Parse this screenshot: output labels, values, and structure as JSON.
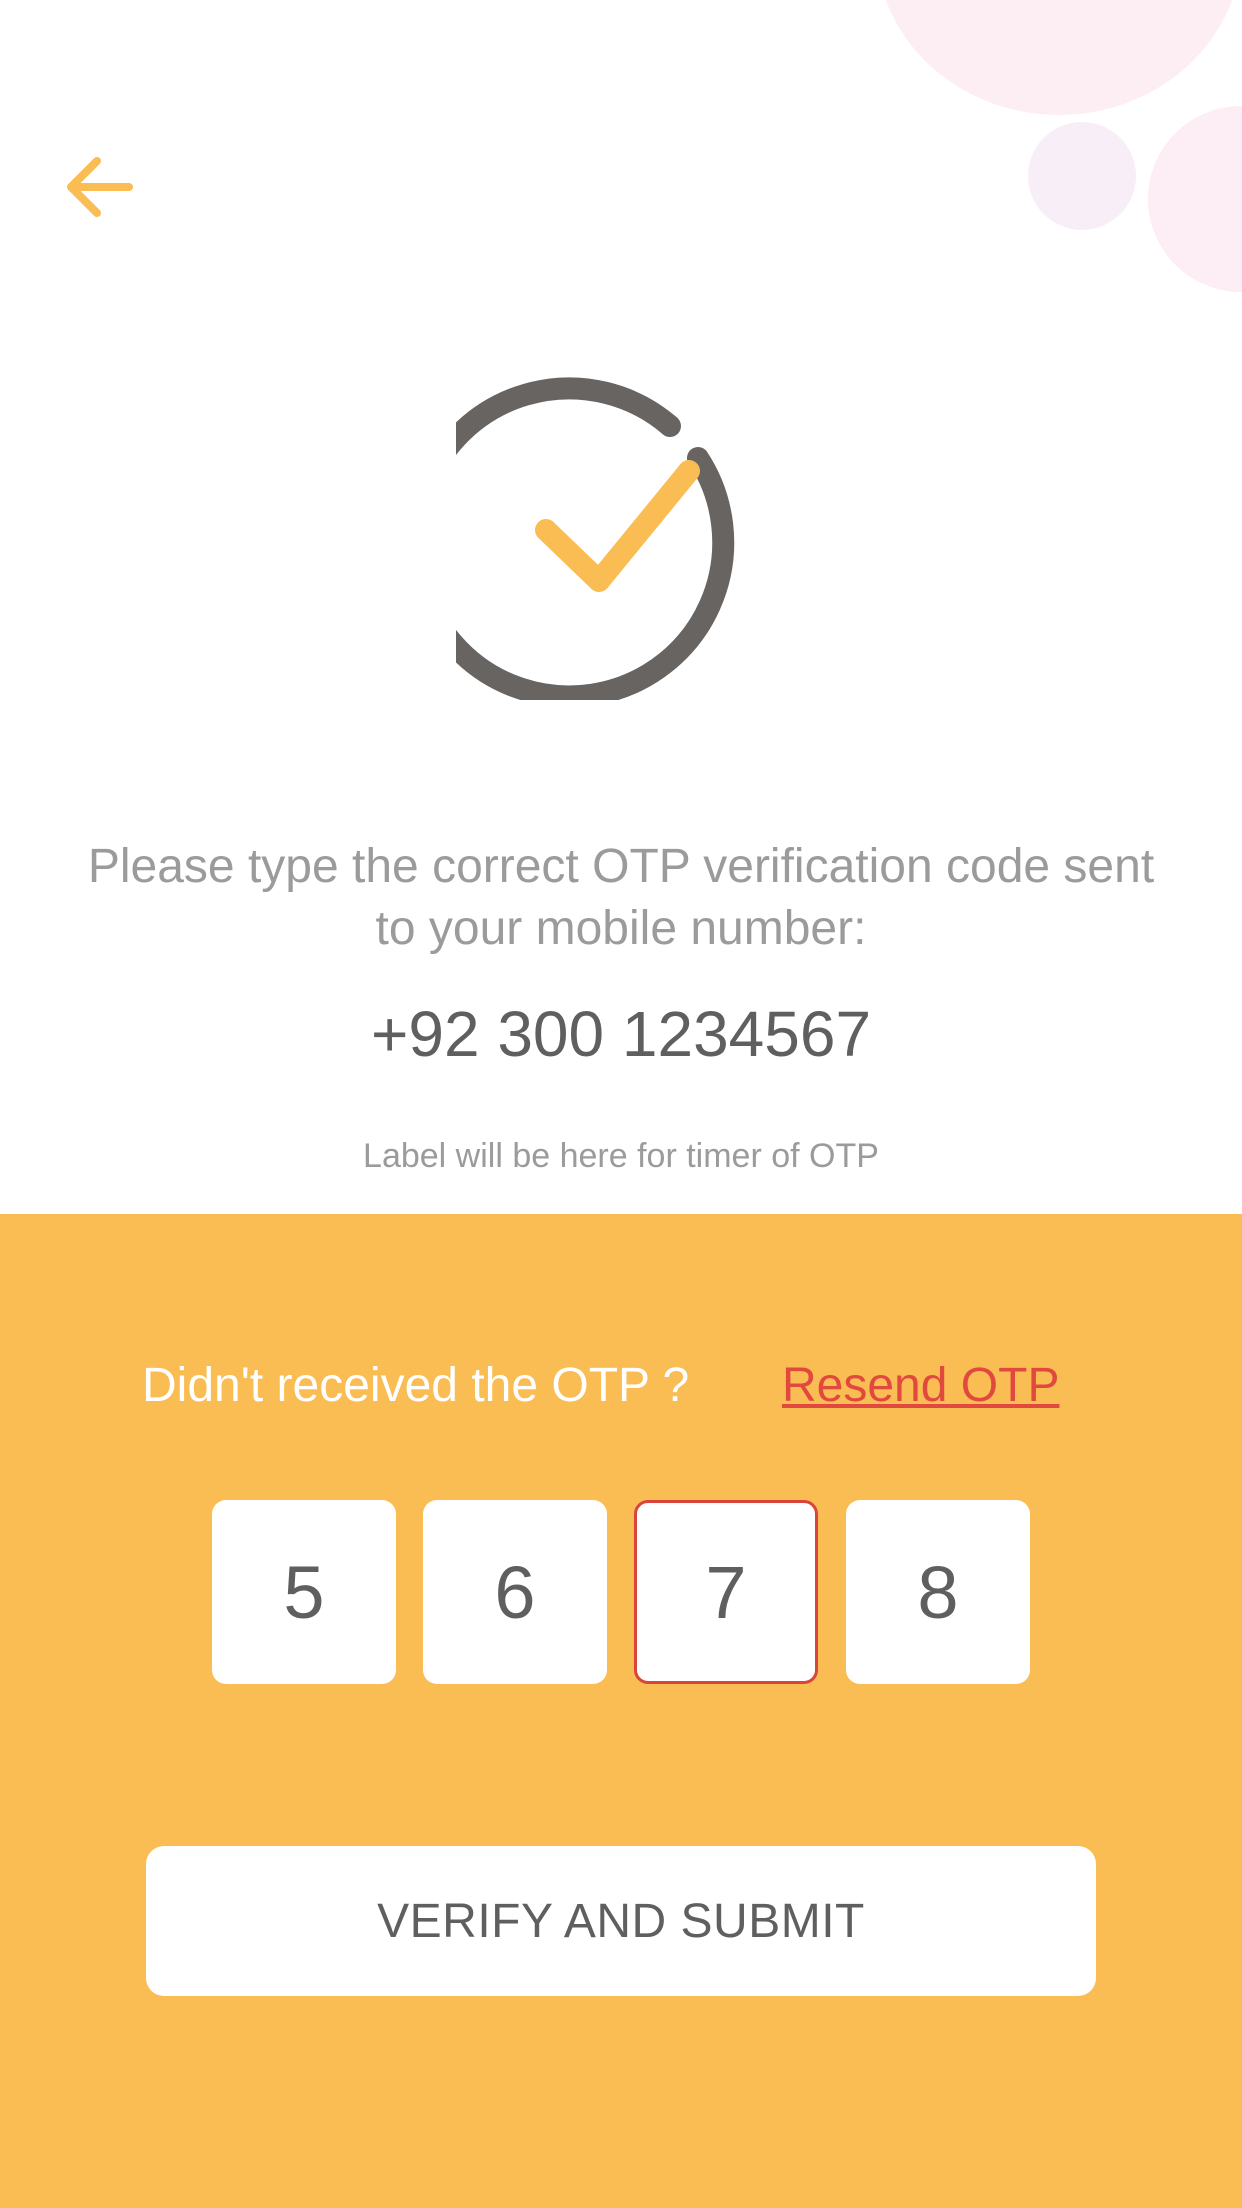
{
  "colors": {
    "accent": "#f9bd54",
    "link": "#e1493e",
    "text_dark": "#5f5f5f",
    "text_muted": "#9b9b9b",
    "decoration_pink": "#fdeef4"
  },
  "header": {
    "back_icon": "arrow-left-icon"
  },
  "illustration": {
    "icon": "check-circle-icon"
  },
  "message": {
    "instruction": "Please type the correct OTP verification code sent to your mobile number:",
    "phone_number": "+92 300 1234567",
    "timer_label": "Label will be here for timer of OTP"
  },
  "resend": {
    "prompt": "Didn't received the OTP ?",
    "link_label": "Resend OTP"
  },
  "otp": {
    "digits": [
      "5",
      "6",
      "7",
      "8"
    ],
    "active_index": 2
  },
  "actions": {
    "verify_label": "VERIFY AND SUBMIT"
  }
}
